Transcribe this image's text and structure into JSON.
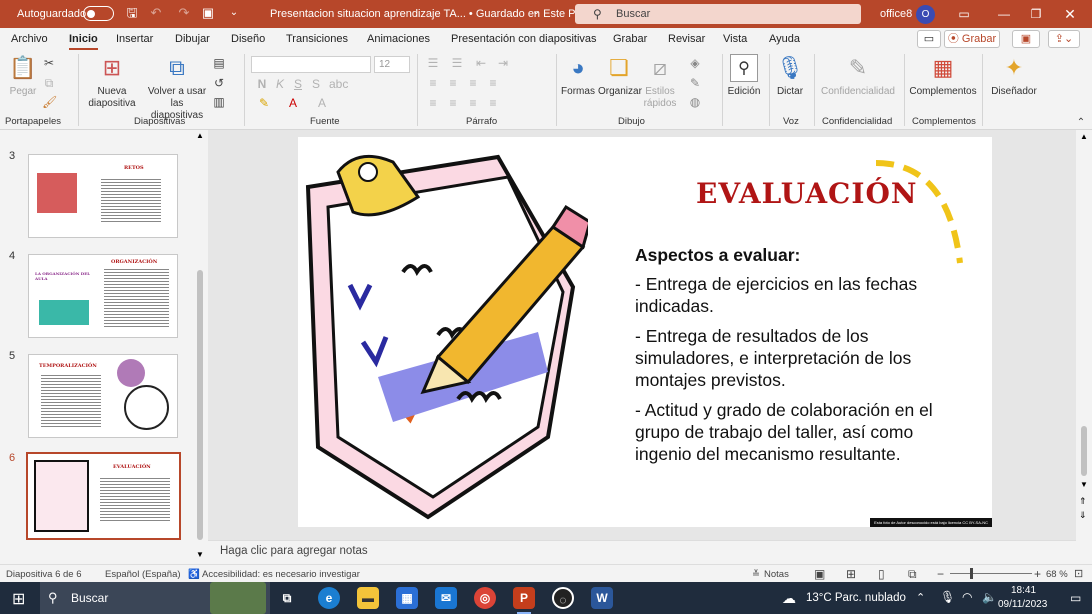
{
  "titlebar": {
    "autosave_label": "Autoguardado",
    "doc_title": "Presentacion situacion aprendizaje TA... • Guardado en Este PC",
    "search_placeholder": "Buscar",
    "user_name": "office8",
    "avatar_letter": "O",
    "icons": [
      "save-icon",
      "undo-icon",
      "redo-icon",
      "present-icon",
      "customize-icon",
      "ribbon-display-icon",
      "minimize-icon",
      "maximize-icon",
      "close-icon"
    ]
  },
  "menu": {
    "items": [
      "Archivo",
      "Inicio",
      "Insertar",
      "Dibujar",
      "Diseño",
      "Transiciones",
      "Animaciones",
      "Presentación con diapositivas",
      "Grabar",
      "Revisar",
      "Vista",
      "Ayuda"
    ],
    "active": "Inicio",
    "record_button": "Grabar"
  },
  "ribbon": {
    "groups": [
      "Portapapeles",
      "Diapositivas",
      "Fuente",
      "Párrafo",
      "Dibujo",
      "Voz",
      "Confidencialidad",
      "Complementos"
    ],
    "paste": "Pegar",
    "new_slide": [
      "Nueva",
      "diapositiva"
    ],
    "reuse": [
      "Volver a usar",
      "las diapositivas"
    ],
    "shapes": "Formas",
    "arrange": "Organizar",
    "quick_styles": [
      "Estilos",
      "rápidos"
    ],
    "editing": "Edición",
    "dictate": "Dictar",
    "sensitivity": "Confidencialidad",
    "addins": "Complementos",
    "designer": "Diseñador",
    "font_size": "12"
  },
  "slides": [
    {
      "num": "3",
      "title": "RETOS"
    },
    {
      "num": "4",
      "title": "ORGANIZACIÓN",
      "side": "LA ORGANIZACIÓN DEL AULA"
    },
    {
      "num": "5",
      "title": "TEMPORALIZACIÓN"
    },
    {
      "num": "6",
      "title": "EVALUACIÓN",
      "selected": true
    }
  ],
  "slide": {
    "title": "EVALUACIÓN",
    "subtitle": "Aspectos a evaluar:",
    "bullets": [
      "- Entrega de ejercicios en las fechas indicadas.",
      "- Entrega de resultados de los simuladores, e interpretación de los montajes previstos.",
      "- Actitud y grado de colaboración en el grupo de trabajo del taller, así como ingenio del mecanismo resultante."
    ],
    "credit": "Esta foto de Autor desconocido está bajo licencia CC BY-SA-NC"
  },
  "notes_placeholder": "Haga clic para agregar notas",
  "status": {
    "slide_count": "Diapositiva 6 de 6",
    "language": "Español (España)",
    "accessibility": "Accesibilidad: es necesario investigar",
    "notes_label": "Notas",
    "zoom": "68 %"
  },
  "taskbar": {
    "search": "Buscar",
    "weather": "13°C  Parc. nublado",
    "time": "18:41",
    "date": "09/11/2023"
  },
  "colors": {
    "accent": "#b7472a",
    "title_red": "#b01515",
    "taskbar": "#1f2c3d"
  }
}
